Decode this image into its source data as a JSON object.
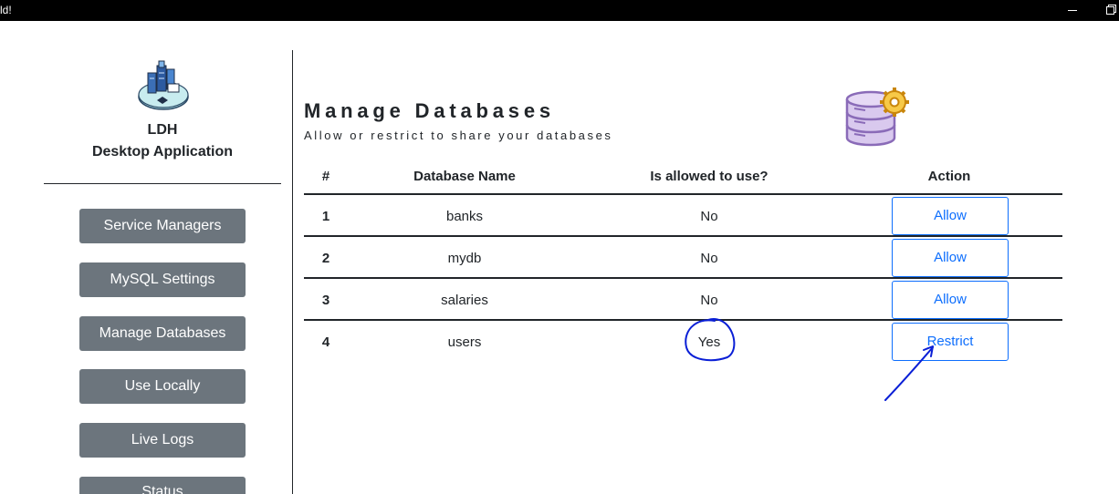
{
  "window": {
    "title_fragment": "ld!"
  },
  "sidebar": {
    "app_name_line1": "LDH",
    "app_name_line2": "Desktop Application",
    "items": [
      {
        "label": "Service Managers"
      },
      {
        "label": "MySQL Settings"
      },
      {
        "label": "Manage Databases"
      },
      {
        "label": "Use Locally"
      },
      {
        "label": "Live Logs"
      },
      {
        "label": "Status"
      }
    ]
  },
  "main": {
    "title": "Manage Databases",
    "subtitle": "Allow or restrict to share your databases",
    "table": {
      "headers": [
        "#",
        "Database Name",
        "Is allowed to use?",
        "Action"
      ],
      "rows": [
        {
          "num": "1",
          "name": "banks",
          "allowed": "No",
          "action": "Allow"
        },
        {
          "num": "2",
          "name": "mydb",
          "allowed": "No",
          "action": "Allow"
        },
        {
          "num": "3",
          "name": "salaries",
          "allowed": "No",
          "action": "Allow"
        },
        {
          "num": "4",
          "name": "users",
          "allowed": "Yes",
          "action": "Restrict"
        }
      ]
    }
  },
  "colors": {
    "titlebar": "#000000",
    "sidebar_button": "#6c757d",
    "action_button": "#0d6efd",
    "annotation_ink": "#0a1fd6"
  },
  "icons": [
    "app-logo-icon",
    "database-gear-icon",
    "minimize-icon",
    "maximize-icon"
  ]
}
